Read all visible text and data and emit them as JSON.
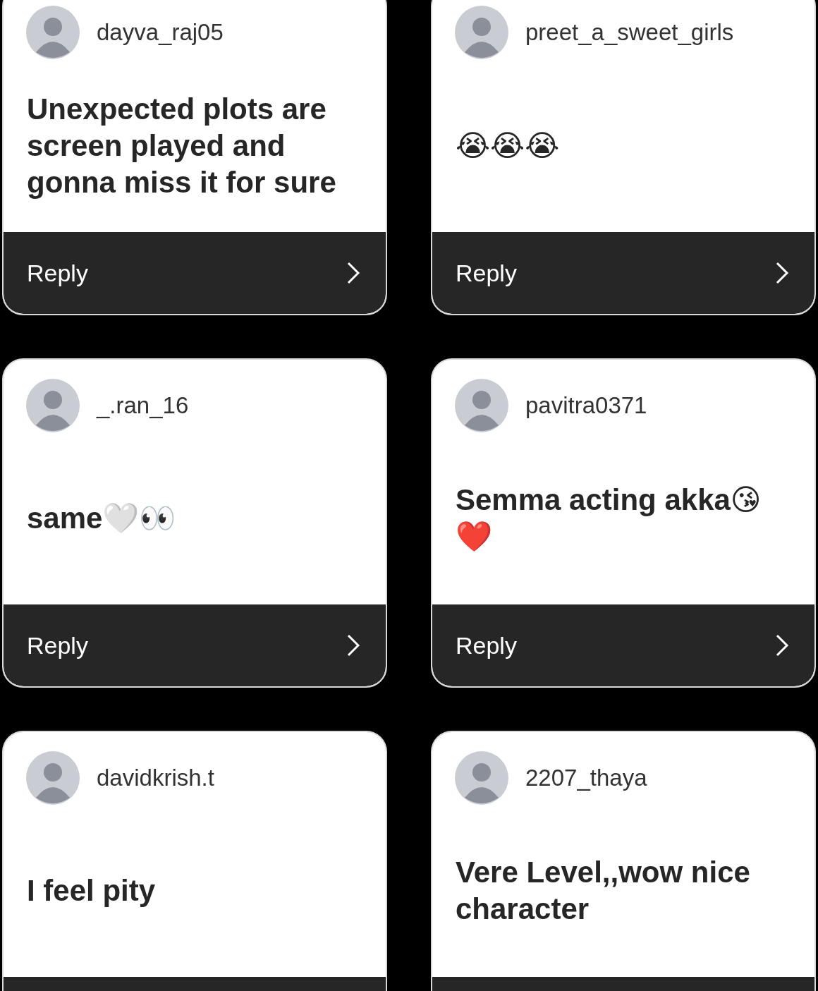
{
  "comments": [
    {
      "username": "dayva_raj05",
      "text": "Unexpected plots are screen played and gonna miss it for sure",
      "reply": "Reply"
    },
    {
      "username": "preet_a_sweet_girls",
      "text": "😭😭😭",
      "reply": "Reply"
    },
    {
      "username": "_.ran_16",
      "text": "same🤍👀",
      "reply": "Reply"
    },
    {
      "username": "pavitra0371",
      "text": "Semma acting akka😘❤️",
      "reply": "Reply"
    },
    {
      "username": "davidkrish.t",
      "text": "I feel pity"
    },
    {
      "username": "2207_thaya",
      "text": "Vere Level,,wow nice character"
    }
  ]
}
